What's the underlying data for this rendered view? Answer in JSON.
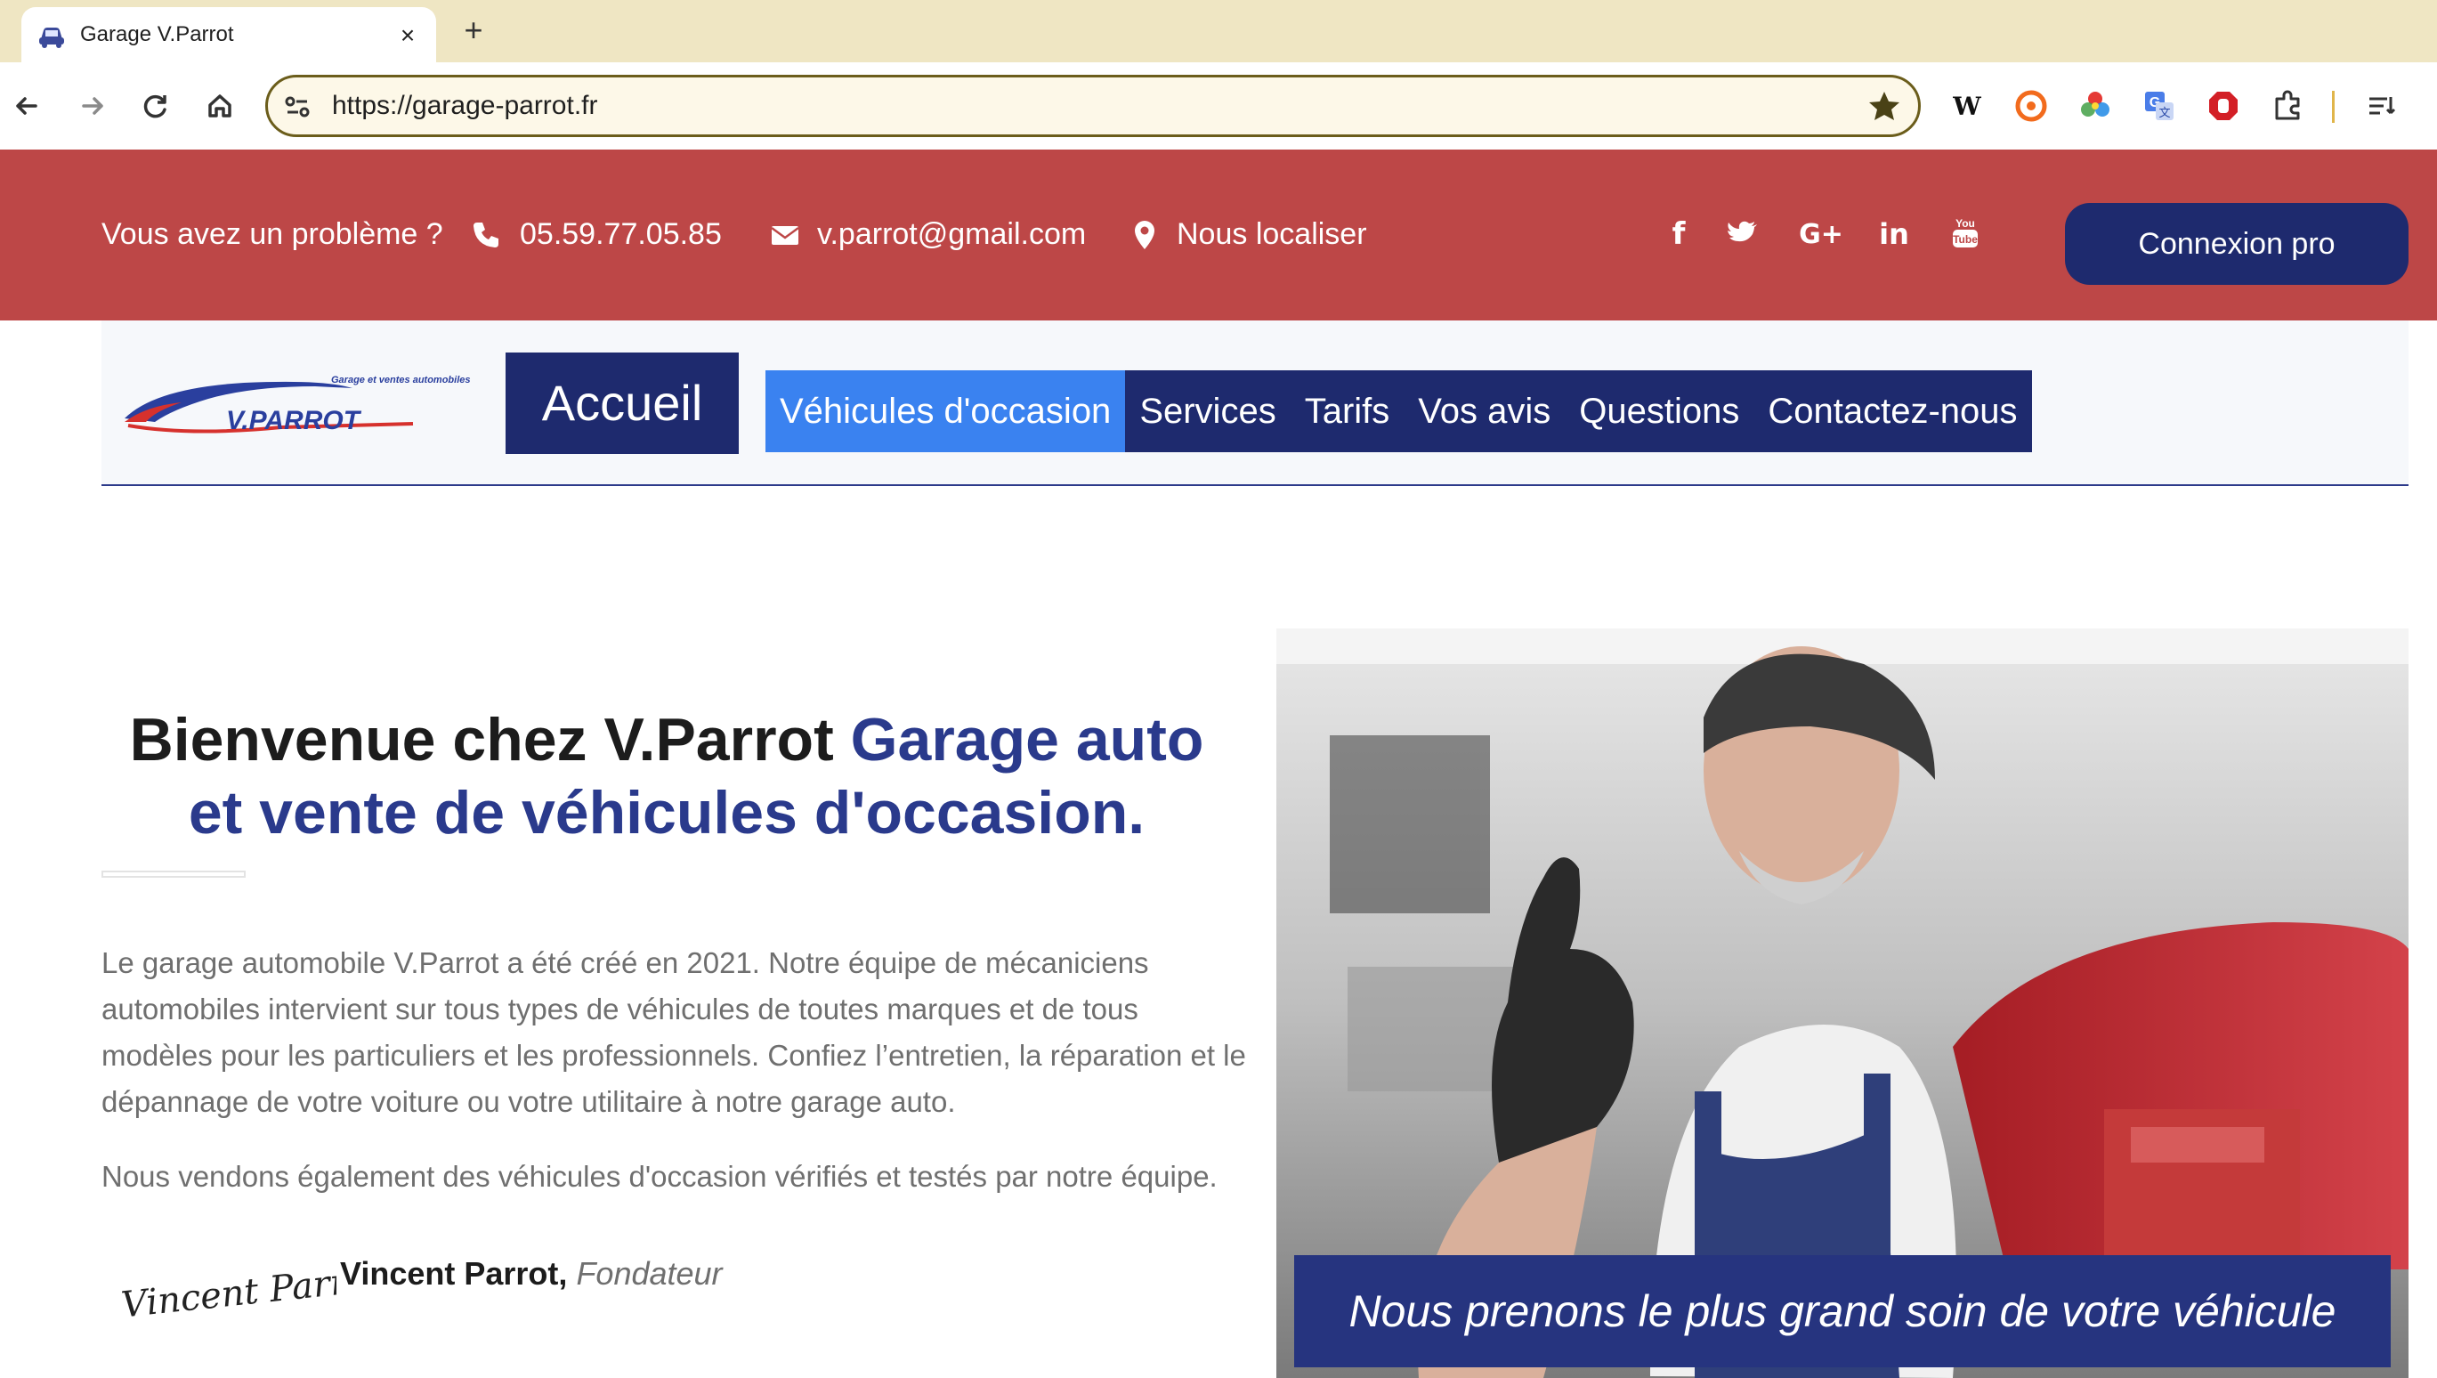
{
  "browser": {
    "tab_title": "Garage V.Parrot",
    "tab_close": "×",
    "new_tab": "+",
    "url": "https://garage-parrot.fr",
    "icons": [
      "back-icon",
      "forward-icon",
      "reload-icon",
      "home-icon",
      "site-info-icon",
      "bookmark-star-icon",
      "extensions-icon",
      "reading-list-icon"
    ]
  },
  "topbar": {
    "problem": "Vous avez un problème ?",
    "phone": "05.59.77.05.85",
    "email": "v.parrot@gmail.com",
    "locate": "Nous localiser",
    "social": [
      "f",
      "twitter",
      "G+",
      "in",
      "YouTube"
    ],
    "login": "Connexion pro",
    "colors": {
      "bar": "#bd4747",
      "navy": "#1e2a6e"
    }
  },
  "nav": {
    "logo_brand": "V.PARROT",
    "logo_tagline": "Garage et ventes automobiles",
    "home": "Accueil",
    "items": [
      {
        "label": "Véhicules d'occasion",
        "active": true
      },
      {
        "label": "Services"
      },
      {
        "label": "Tarifs"
      },
      {
        "label": "Vos avis"
      },
      {
        "label": "Questions"
      },
      {
        "label": "Contactez-nous"
      }
    ],
    "active_color": "#3a82f0"
  },
  "content": {
    "title_dark": "Bienvenue chez V.Parrot ",
    "title_accent": "Garage auto et vente de véhicules d'occasion.",
    "paragraph1": "Le garage automobile V.Parrot a été créé en 2021. Notre équipe de mécaniciens automobiles intervient sur tous types de véhicules de toutes marques et de tous modèles pour les particuliers et les professionnels. Confiez l’entretien, la réparation et le dépannage de votre voiture ou votre utilitaire à notre garage auto.",
    "paragraph2": "Nous vendons également des véhicules d'occasion vérifiés et testés par notre équipe.",
    "signature": "Vincent Parrot",
    "founder_name": "Vincent Parrot,",
    "founder_role": "Fondateur",
    "hero_caption": "Nous prenons le plus grand soin de votre véhicule"
  }
}
